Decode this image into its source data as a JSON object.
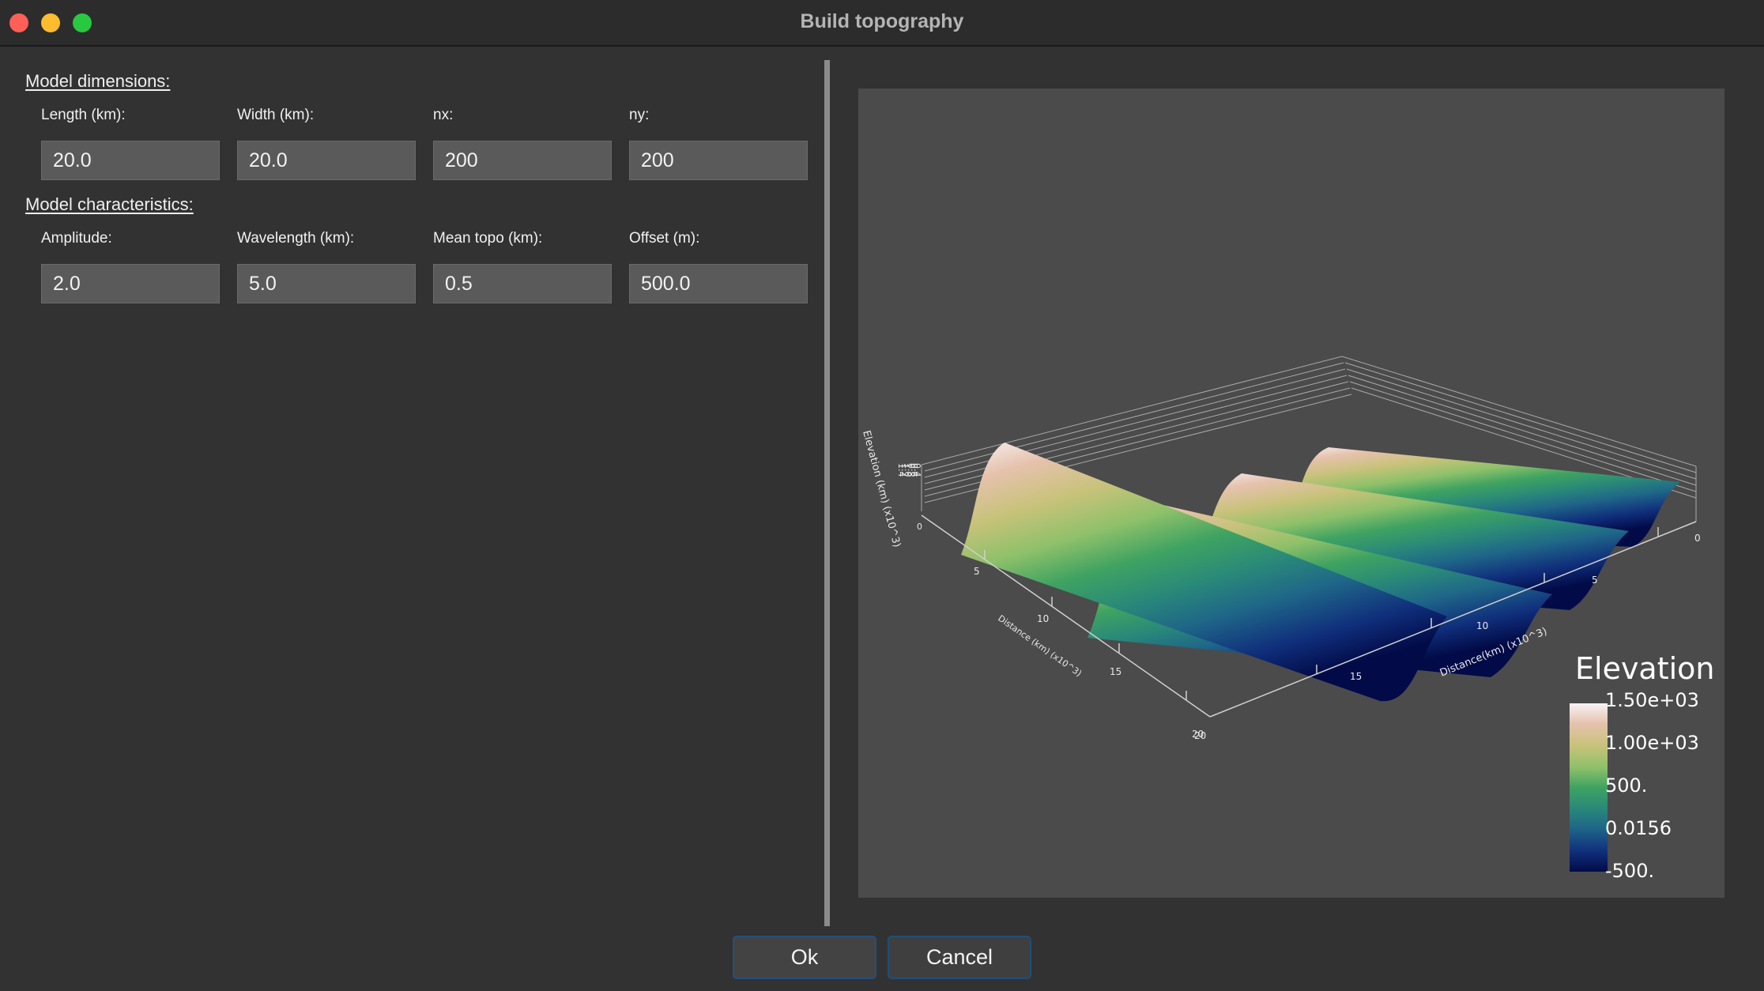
{
  "window": {
    "title": "Build topography"
  },
  "dimensions": {
    "title": "Model dimensions:",
    "fields": [
      {
        "label": "Length (km):",
        "value": "20.0"
      },
      {
        "label": "Width (km):",
        "value": "20.0"
      },
      {
        "label": "nx:",
        "value": "200"
      },
      {
        "label": "ny:",
        "value": "200"
      }
    ]
  },
  "characteristics": {
    "title": "Model characteristics:",
    "fields": [
      {
        "label": "Amplitude:",
        "value": "2.0"
      },
      {
        "label": "Wavelength (km):",
        "value": "5.0"
      },
      {
        "label": "Mean topo (km):",
        "value": "0.5"
      },
      {
        "label": "Offset (m):",
        "value": "500.0"
      }
    ]
  },
  "plot": {
    "z_axis_title": "Elevation (km) (x10^3)",
    "z_tick_labels": [
      "0",
      "1.4",
      "1.2",
      "1.0",
      "0.8",
      "0.6",
      "0.4"
    ],
    "near_axis_title": "Distance (km) (x10^3)",
    "near_axis_ticks": [
      "5",
      "10",
      "15",
      "20"
    ],
    "right_axis_title": "Distance(km) (x10^3)",
    "right_axis_ticks": [
      "0",
      "5",
      "10",
      "15",
      "20"
    ],
    "colorbar": {
      "title": "Elevation",
      "labels": [
        "1.50e+03",
        "1.00e+03",
        "500.",
        "0.0156",
        "-500."
      ]
    },
    "colormap": [
      "#f7f3f5",
      "#e6c2ad",
      "#c8c27a",
      "#8fc16a",
      "#3fa361",
      "#2a8a78",
      "#1f6788",
      "#102f7c",
      "#020b48"
    ]
  },
  "buttons": {
    "ok": "Ok",
    "cancel": "Cancel"
  }
}
